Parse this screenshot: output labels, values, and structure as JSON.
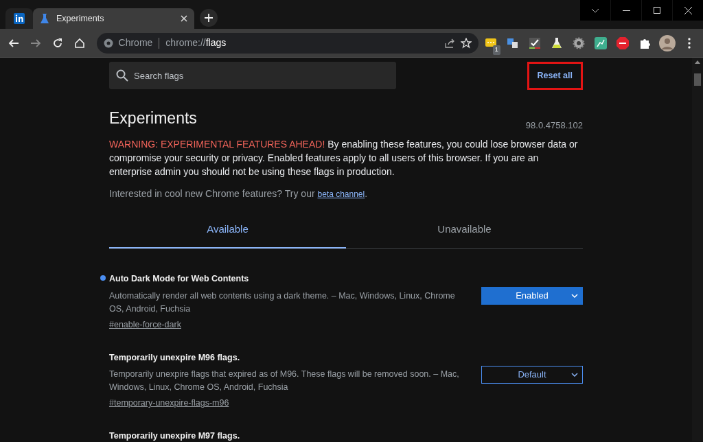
{
  "tabs": [
    {
      "kind": "pinned",
      "selected": false
    },
    {
      "kind": "normal",
      "title": "Experiments",
      "selected": true
    }
  ],
  "omnibox": {
    "site": "Chrome",
    "url_prefix": "chrome://",
    "url_host": "flags"
  },
  "extension_badge": "1",
  "search": {
    "placeholder": "Search flags"
  },
  "reset_button": {
    "label": "Reset all",
    "highlighted": true
  },
  "title": "Experiments",
  "version": "98.0.4758.102",
  "warning": {
    "alert": "WARNING: EXPERIMENTAL FEATURES AHEAD!",
    "text": " By enabling these features, you could lose browser data or compromise your security or privacy. Enabled features apply to all users of this browser. If you are an enterprise admin you should not be using these flags in production."
  },
  "promo": {
    "text": "Interested in cool new Chrome features? Try our ",
    "link": "beta channel",
    "after": "."
  },
  "page_tabs": [
    {
      "label": "Available",
      "selected": true
    },
    {
      "label": "Unavailable",
      "selected": false
    }
  ],
  "flags": [
    {
      "name": "Auto Dark Mode for Web Contents",
      "description": "Automatically render all web contents using a dark theme. – Mac, Windows, Linux, Chrome OS, Android, Fuchsia",
      "anchor": "#enable-force-dark",
      "value": "Enabled",
      "modified": true
    },
    {
      "name": "Temporarily unexpire M96 flags.",
      "description": "Temporarily unexpire flags that expired as of M96. These flags will be removed soon. – Mac, Windows, Linux, Chrome OS, Android, Fuchsia",
      "anchor": "#temporary-unexpire-flags-m96",
      "value": "Default",
      "modified": false
    },
    {
      "name": "Temporarily unexpire M97 flags.",
      "modified": false
    }
  ]
}
